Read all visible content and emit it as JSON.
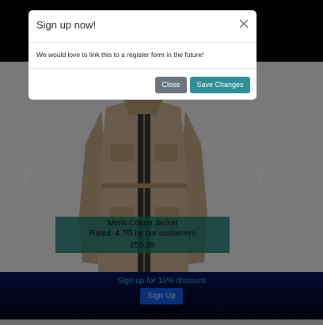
{
  "modal": {
    "title": "Sign up now!",
    "close_icon": "close-icon",
    "body_text": "We would love to link this to a register form in the future!",
    "close_button": "Close",
    "save_button": "Save Changes"
  },
  "carousel": {
    "prev_icon": "chevron-left-icon",
    "next_icon": "chevron-right-icon",
    "product": {
      "name": "Mens Cotton Jacket",
      "rating": "Rated: 4.7/5 by our customers",
      "price": "£55.99"
    }
  },
  "promo": {
    "text": "Sign up for 10% discount",
    "button": "Sign Up"
  },
  "colors": {
    "save_button": "#2f8f95",
    "close_button": "#6c757d",
    "caption_bg": "#1f7f71",
    "signup_button": "#1060f0"
  }
}
